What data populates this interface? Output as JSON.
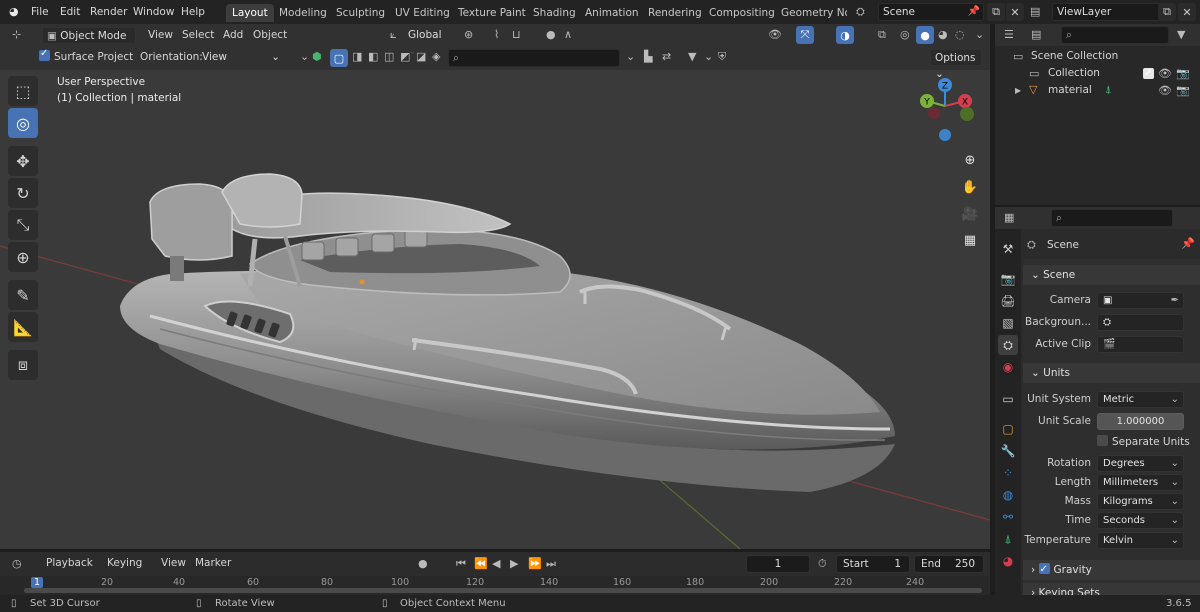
{
  "menu": {
    "file": "File",
    "edit": "Edit",
    "render": "Render",
    "window": "Window",
    "help": "Help",
    "workspaces": [
      "Layout",
      "Modeling",
      "Sculpting",
      "UV Editing",
      "Texture Paint",
      "Shading",
      "Animation",
      "Rendering",
      "Compositing",
      "Geometry Noc"
    ],
    "scene_name": "Scene",
    "view_layer": "ViewLayer"
  },
  "viewport_header": {
    "mode": "Object Mode",
    "view": "View",
    "select": "Select",
    "add": "Add",
    "object": "Object",
    "transform_orientation": "Global"
  },
  "tool_header": {
    "surface_project": "Surface Project",
    "orientation_label": "Orientation:",
    "orientation_value": "View",
    "options": "Options"
  },
  "viewport_overlay": {
    "perspective": "User Perspective",
    "collection_info": "(1) Collection | material"
  },
  "gizmo": {
    "z": "Z",
    "y": "Y",
    "x": "X"
  },
  "timeline": {
    "playback": "Playback",
    "keying": "Keying",
    "view": "View",
    "marker": "Marker",
    "current_frame": "1",
    "start_label": "Start",
    "start_value": "1",
    "end_label": "End",
    "end_value": "250",
    "ticks": [
      "1",
      "20",
      "40",
      "60",
      "80",
      "100",
      "120",
      "140",
      "160",
      "180",
      "200",
      "220",
      "240"
    ]
  },
  "statusbar": {
    "hint1": "Set 3D Cursor",
    "hint2": "Rotate View",
    "hint3": "Object Context Menu",
    "version": "3.6.5"
  },
  "outliner": {
    "scene_collection": "Scene Collection",
    "collection": "Collection",
    "object": "material"
  },
  "properties": {
    "header_title": "Scene",
    "scene_panel": "Scene",
    "camera_label": "Camera",
    "background_label": "Backgroun...",
    "active_clip_label": "Active Clip",
    "units_panel": "Units",
    "unit_system_label": "Unit System",
    "unit_system_value": "Metric",
    "unit_scale_label": "Unit Scale",
    "unit_scale_value": "1.000000",
    "separate_units": "Separate Units",
    "rotation_label": "Rotation",
    "rotation_value": "Degrees",
    "length_label": "Length",
    "length_value": "Millimeters",
    "mass_label": "Mass",
    "mass_value": "Kilograms",
    "time_label": "Time",
    "time_value": "Seconds",
    "temperature_label": "Temperature",
    "temperature_value": "Kelvin",
    "gravity_panel": "Gravity",
    "keying_sets_panel": "Keying Sets"
  },
  "colors": {
    "accent": "#4772b3",
    "axis_x": "#d33f4f",
    "axis_y": "#7bb33a",
    "axis_z": "#3d8bd9",
    "viewport_bg": "#3a3a3a"
  }
}
